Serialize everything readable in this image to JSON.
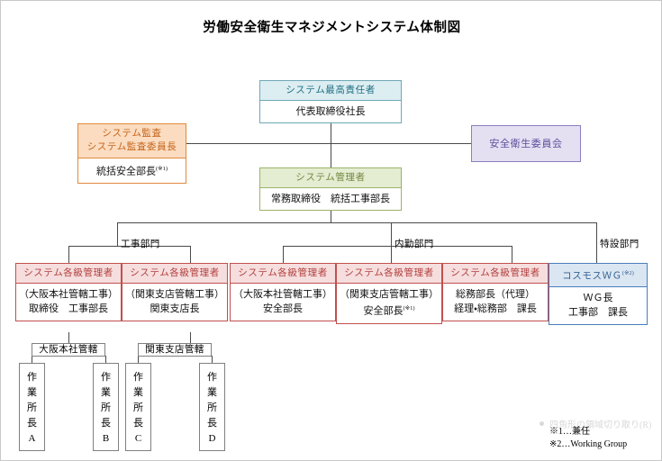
{
  "title": "労働安全衛生マネジメントシステム体制図",
  "top": {
    "chief": {
      "header": "システム最高責任者",
      "body": "代表取締役社長"
    },
    "audit": {
      "header_line1": "システム監査",
      "header_line2": "システム監査委員長",
      "body": "統括安全部長",
      "body_sup": "(※1)"
    },
    "committee": {
      "label": "安全衛生委員会"
    },
    "manager": {
      "header": "システム管理者",
      "body": "常務取締役　統括工事部長"
    }
  },
  "divisions": {
    "construction": "工事部門",
    "office": "内勤部門",
    "special": "特設部門"
  },
  "managers": [
    {
      "header": "システム各級管理者",
      "line1": "（大阪本社管轄工事）",
      "line2": "取締役　工事部長",
      "sup": "",
      "variant": "v-red"
    },
    {
      "header": "システム各級管理者",
      "line1": "（関東支店管轄工事）",
      "line2": "関東支店長",
      "sup": "",
      "variant": "v-red"
    },
    {
      "header": "システム各級管理者",
      "line1": "（大阪本社管轄工事）",
      "line2": "安全部長",
      "sup": "",
      "variant": "v-red"
    },
    {
      "header": "システム各級管理者",
      "line1": "（関東支店管轄工事）",
      "line2": "安全部長",
      "sup": "(※1)",
      "variant": "v-red"
    },
    {
      "header": "システム各級管理者",
      "line1": "総務部長（代理）",
      "line2": "経理・総務部　課長",
      "sup": "",
      "variant": "v-red"
    },
    {
      "header": "コスモスＷＧ",
      "header_sup": "(※2)",
      "line1": "ＷＧ長",
      "line2": "工事部　課長",
      "sup": "",
      "variant": "v-blue"
    }
  ],
  "site_groups": [
    {
      "label": "大阪本社管轄"
    },
    {
      "label": "関東支店管轄"
    }
  ],
  "sites": [
    {
      "chars": [
        "作",
        "業",
        "所",
        "長",
        "A"
      ]
    },
    {
      "chars": [
        "作",
        "業",
        "所",
        "長",
        "B"
      ]
    },
    {
      "chars": [
        "作",
        "業",
        "所",
        "長",
        "C"
      ]
    },
    {
      "chars": [
        "作",
        "業",
        "所",
        "長",
        "D"
      ]
    }
  ],
  "notes": {
    "note1": "※1…兼任",
    "note2": "※2…Working Group"
  },
  "watermark": {
    "text": "四角形の領域切り取り(R)"
  },
  "colors": {
    "cyan": "#6fa8b5",
    "orange": "#e08a3c",
    "green": "#9bb36a",
    "purple": "#8b7fc0",
    "red": "#c0504d",
    "blue": "#4a7ebb",
    "line": "#4a4a4a"
  }
}
